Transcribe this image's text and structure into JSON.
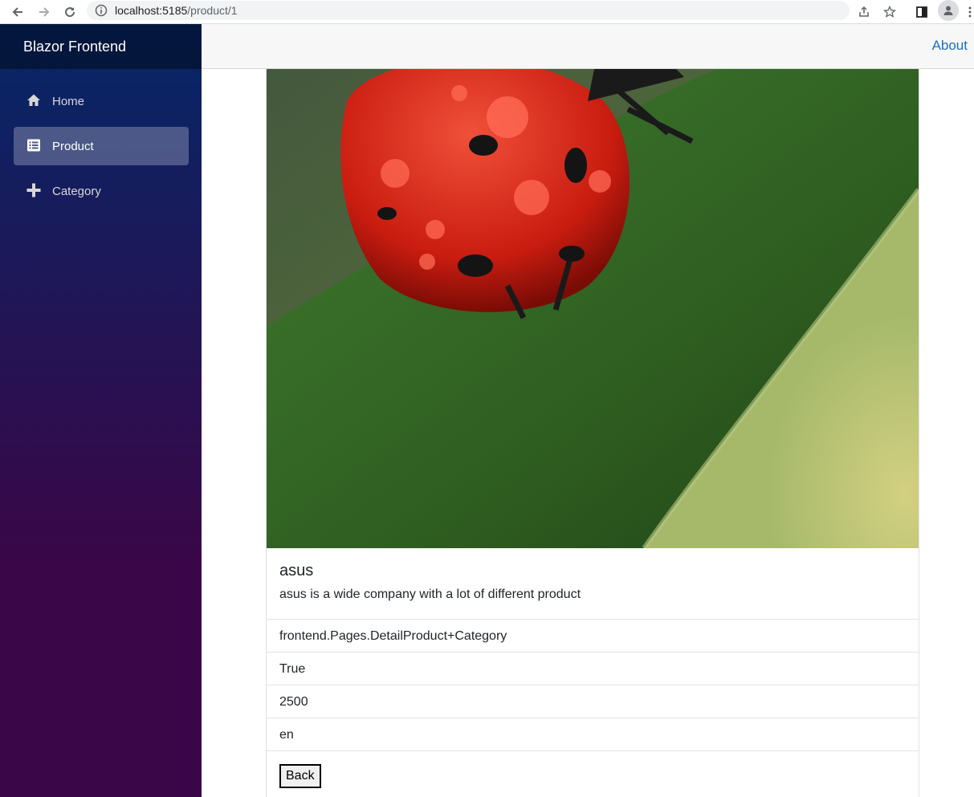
{
  "browser": {
    "url_host": "localhost:5185",
    "url_path": "/product/1"
  },
  "sidebar": {
    "brand": "Blazor Frontend",
    "items": [
      {
        "label": "Home",
        "icon": "home-icon",
        "active": false
      },
      {
        "label": "Product",
        "icon": "list-icon",
        "active": true
      },
      {
        "label": "Category",
        "icon": "plus-icon",
        "active": false
      }
    ]
  },
  "top_row": {
    "about_label": "About"
  },
  "product": {
    "image_alt": "ladybug",
    "title": "asus",
    "description": "asus is a wide company with a lot of different product",
    "details": [
      "frontend.Pages.DetailProduct+Category",
      "True",
      "2500",
      "en"
    ],
    "back_label": "Back"
  },
  "colors": {
    "sidebar_top": "#052767",
    "sidebar_bottom": "#3a0647",
    "link": "#1b6ec2"
  }
}
